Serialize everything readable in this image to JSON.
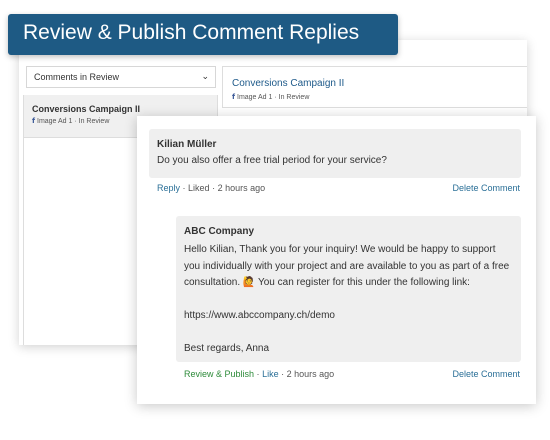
{
  "banner": {
    "title": "Review & Publish Comment Replies"
  },
  "filter": {
    "selected": "Comments in Review"
  },
  "left_list": {
    "items": [
      {
        "title": "Conversions Campaign II",
        "platform_icon": "f",
        "meta": "Image Ad 1 · In Review"
      }
    ]
  },
  "detail_header": {
    "title": "Conversions Campaign II",
    "platform_icon": "f",
    "meta": "Image Ad 1 · In Review"
  },
  "comment": {
    "author": "Kilian Müller",
    "text": "Do you also offer a free trial period for your service?",
    "reply_label": "Reply",
    "liked_label": "Liked",
    "time": "2 hours ago",
    "delete_label": "Delete Comment"
  },
  "reply": {
    "author": "ABC Company",
    "text": "Hello Kilian, Thank you for your inquiry! We would be happy to support you individually with your project and are available to you as part of a free consultation. 🙋 You can register for this under the following link:\n\nhttps://www.abccompany.ch/demo\n\nBest regards, Anna",
    "review_publish_label": "Review & Publish",
    "like_label": "Like",
    "time": "2 hours ago",
    "delete_label": "Delete Comment"
  },
  "colors": {
    "banner": "#1e5a84",
    "link": "#2a6f97",
    "publish": "#2e8b3a"
  }
}
